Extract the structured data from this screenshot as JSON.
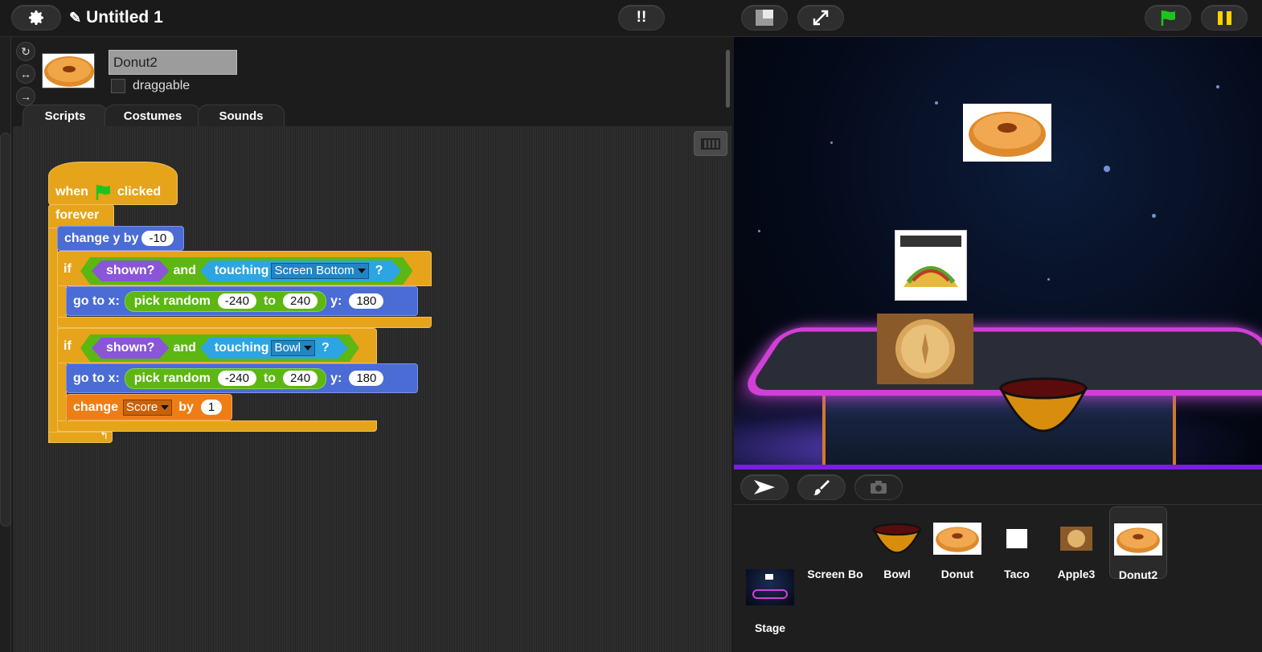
{
  "project": {
    "title": "Untitled 1"
  },
  "toolbar": {
    "step_label": "!!"
  },
  "sprite": {
    "name": "Donut2",
    "draggable_label": "draggable",
    "draggable": false
  },
  "tabs": [
    {
      "label": "Scripts",
      "active": true
    },
    {
      "label": "Costumes",
      "active": false
    },
    {
      "label": "Sounds",
      "active": false
    }
  ],
  "script": {
    "hat": {
      "when": "when",
      "clicked": "clicked"
    },
    "forever": "forever",
    "change_y": {
      "label": "change y by",
      "value": "-10"
    },
    "if1": {
      "if": "if",
      "shown": "shown?",
      "and": "and",
      "touching": "touching",
      "target": "Screen Bottom",
      "q": "?",
      "goto": {
        "label": "go to x:",
        "pick": "pick random",
        "from": "-240",
        "to_word": "to",
        "to": "240",
        "y_label": "y:",
        "y": "180"
      }
    },
    "if2": {
      "if": "if",
      "shown": "shown?",
      "and": "and",
      "touching": "touching",
      "target": "Bowl",
      "q": "?",
      "goto": {
        "label": "go to x:",
        "pick": "pick random",
        "from": "-240",
        "to_word": "to",
        "to": "240",
        "y_label": "y:",
        "y": "180"
      },
      "change": {
        "label": "change",
        "var": "Score",
        "by": "by",
        "value": "1"
      }
    }
  },
  "corral": {
    "sprites": [
      {
        "name": "Screen Bo",
        "selected": false
      },
      {
        "name": "Bowl",
        "selected": false
      },
      {
        "name": "Donut",
        "selected": false
      },
      {
        "name": "Taco",
        "selected": false
      },
      {
        "name": "Apple3",
        "selected": false
      },
      {
        "name": "Donut2",
        "selected": true
      }
    ],
    "stage_label": "Stage"
  },
  "colors": {
    "motion": "#4a6cd4",
    "control": "#e5a41a",
    "operators": "#5cb712",
    "looks": "#8a55d7",
    "sensing": "#2ca5e2",
    "variables": "#ee7d16",
    "flag": "#1ec41e",
    "pause": "#ffd200"
  }
}
